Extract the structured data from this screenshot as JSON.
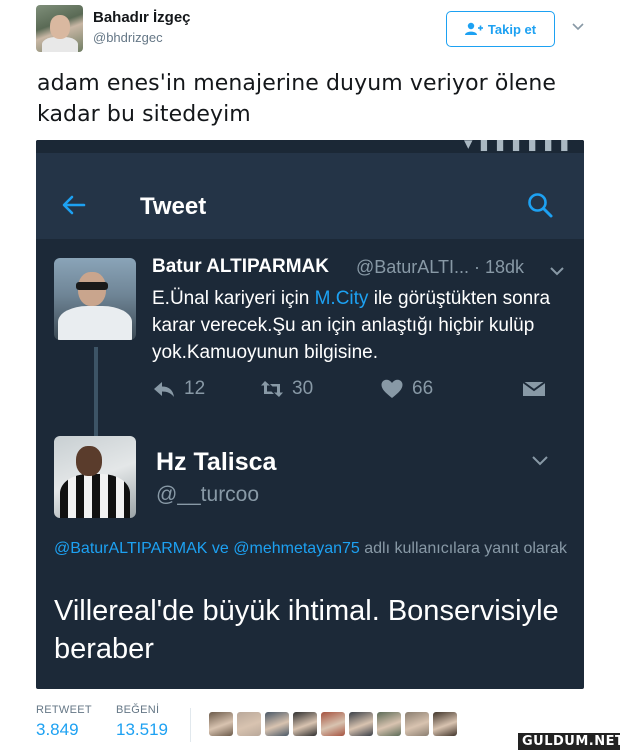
{
  "author": {
    "name": "Bahadır İzgeç",
    "handle": "@bhdrizgec"
  },
  "follow_button": {
    "label": "Takip et"
  },
  "tweet": {
    "text": "adam enes'in menajerine duyum veriyor ölene kadar bu sitedeyim"
  },
  "screenshot": {
    "header": {
      "title": "Tweet"
    },
    "original_tweet": {
      "name": "Batur ALTIPARMAK",
      "handle": "@BaturALTI...",
      "time": "· 18dk",
      "text_before": "E.Ünal kariyeri için ",
      "link": "M.City",
      "text_after": " ile görüştükten sonra karar verecek.Şu an için anlaştığı hiçbir kulüp yok.Kamuoyunun bilgisine.",
      "replies": "12",
      "retweets": "30",
      "likes": "66"
    },
    "reply_tweet": {
      "name": "Hz Talisca",
      "handle": "@__turcoo",
      "reply_link_1": "@BaturALTIPARMAK",
      "reply_and": " ve ",
      "reply_link_2": "@mehmetayan75",
      "reply_suffix": " adlı kullanıcılara yanıt olarak",
      "text": "Villereal'de büyük ihtimal. Bonservisiyle beraber"
    }
  },
  "stats": {
    "retweet_label": "RETWEET",
    "retweet_count": "3.849",
    "like_label": "BEĞENİ",
    "like_count": "13.519",
    "liker_colors": [
      "#6b5a4a",
      "#b9a89a",
      "#4a5866",
      "#2f2f2f",
      "#a5523f",
      "#3a3f47",
      "#5c6b57",
      "#8a7e70",
      "#41352b"
    ]
  },
  "watermark": "GULDUM.NET",
  "colors": {
    "accent": "#1da1f2",
    "dark_bg": "#1c2938",
    "dark_header": "#243447"
  }
}
